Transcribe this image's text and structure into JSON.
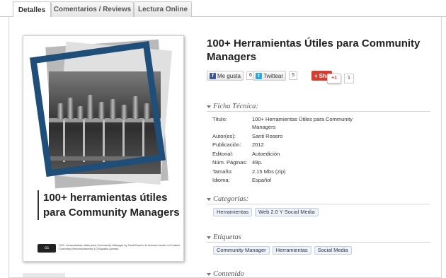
{
  "tabs": [
    "Detalles",
    "Comentarios / Reviews",
    "Lectura Online"
  ],
  "book": {
    "title": "100+ Herramientas Útiles para Community Managers",
    "cover_title": "100+ herramientas útiles para Community Managers",
    "cover_license": "100+ herramientas útiles para Community Manager by Santi Rosero is licensed under a Creative Commons Reconocimiento 3.0 España License."
  },
  "social": {
    "facebook_label": "Me gusta",
    "facebook_count": "6",
    "twitter_label": "Twittear",
    "twitter_count": "5",
    "share_label": "Sha",
    "gplus_label": "+1",
    "gplus_count": "1"
  },
  "sections": {
    "ficha": "Ficha Técnica:",
    "categorias": "Categorías:",
    "etiquetas": "Etiquetas",
    "contenido": "Contenido"
  },
  "specs": [
    {
      "label": "Título:",
      "value": "100+ Herramientas Útiles para Community Managers"
    },
    {
      "label": "Autor(es):",
      "value": "Santi Rosero"
    },
    {
      "label": "Publicación:",
      "value": "2012"
    },
    {
      "label": "Editorial:",
      "value": "Autoedición"
    },
    {
      "label": "Núm. Páginas:",
      "value": "49p."
    },
    {
      "label": "Tamaño:",
      "value": "2.15 Mbs (zip)"
    },
    {
      "label": "Idioma:",
      "value": "Español"
    }
  ],
  "categories": [
    "Herramientas",
    "Web 2.0 Y Social Media"
  ],
  "tags": [
    "Community Manager",
    "Herramientas",
    "Social Media"
  ],
  "colors": {
    "frame_blue": "#1f4e79",
    "facebook_blue": "#3b5998",
    "twitter_blue": "#2aa9e0",
    "share_red": "#d23f31"
  }
}
